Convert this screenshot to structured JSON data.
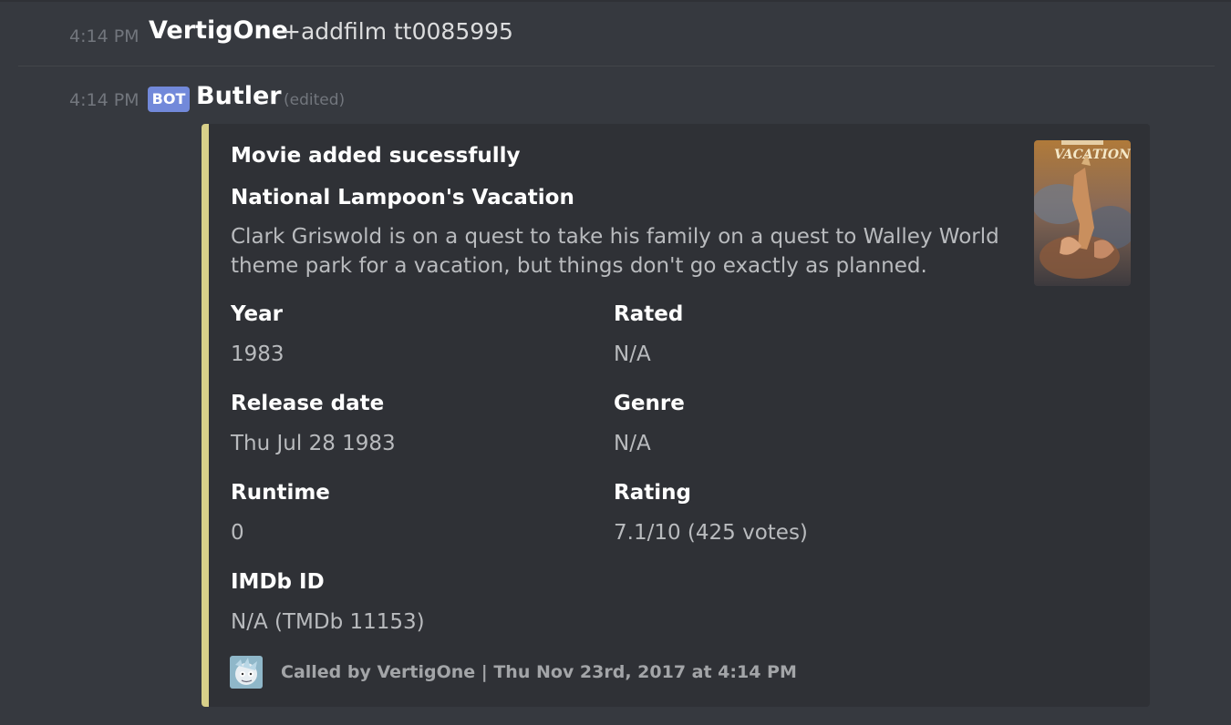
{
  "messages": [
    {
      "timestamp": "4:14 PM",
      "author": "VertigOne",
      "content": "+addfilm tt0085995"
    },
    {
      "timestamp": "4:14 PM",
      "badge": "BOT",
      "author": "Butler",
      "edited_label": "(edited)"
    }
  ],
  "embed": {
    "accent_color": "#d8d08a",
    "title": "Movie added sucessfully",
    "subtitle": "National Lampoon's Vacation",
    "description": "Clark Griswold is on a quest to take his family on a quest to Walley World theme park for a vacation, but things don't go exactly as planned.",
    "thumbnail_text": "VACATION",
    "fields": [
      {
        "name": "Year",
        "value": "1983"
      },
      {
        "name": "Rated",
        "value": "N/A"
      },
      {
        "name": "Release date",
        "value": "Thu Jul 28 1983"
      },
      {
        "name": "Genre",
        "value": "N/A"
      },
      {
        "name": "Runtime",
        "value": "0"
      },
      {
        "name": "Rating",
        "value": "7.1/10 (425 votes)"
      },
      {
        "name": "IMDb ID",
        "value": "N/A (TMDb 11153)"
      }
    ],
    "footer": "Called by VertigOne | Thu Nov 23rd, 2017 at 4:14 PM"
  },
  "colors": {
    "background": "#36393f",
    "embed_background": "#2f3136",
    "bot_badge": "#7289da"
  }
}
